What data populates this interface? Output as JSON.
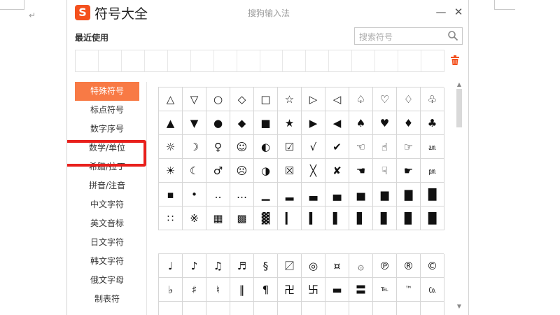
{
  "app": {
    "title": "符号大全",
    "logo_text": "S",
    "ime_name": "搜狗输入法",
    "minimize_glyph": "—",
    "close_glyph": "✕"
  },
  "recent": {
    "label": "最近使用",
    "cell_count": 16
  },
  "search": {
    "placeholder": "搜索符号"
  },
  "sidebar": {
    "items": [
      {
        "label": "特殊符号",
        "active": true
      },
      {
        "label": "标点符号"
      },
      {
        "label": "数字序号"
      },
      {
        "label": "数学/单位",
        "highlighted": true
      },
      {
        "label": "希腊/拉丁"
      },
      {
        "label": "拼音/注音"
      },
      {
        "label": "中文字符"
      },
      {
        "label": "英文音标"
      },
      {
        "label": "日文字符"
      },
      {
        "label": "韩文字符"
      },
      {
        "label": "俄文字母"
      },
      {
        "label": "制表符"
      }
    ]
  },
  "symbols_block1": [
    "△",
    "▽",
    "○",
    "◇",
    "□",
    "☆",
    "▷",
    "◁",
    "♤",
    "♡",
    "♢",
    "♧",
    "▲",
    "▼",
    "●",
    "◆",
    "■",
    "★",
    "▶",
    "◀",
    "♠",
    "♥",
    "♦",
    "♣",
    "☼",
    "☽",
    "♀",
    "☺",
    "◐",
    "☑",
    "√",
    "✔",
    "☜",
    "☝",
    "☞",
    "㏂",
    "☀",
    "☾",
    "♂",
    "☹",
    "◑",
    "☒",
    "╳",
    "✘",
    "☚",
    "☟",
    "☛",
    "㏘",
    "▪",
    "•",
    "‥",
    "…",
    "▁",
    "▂",
    "▃",
    "▄",
    "▅",
    "▆",
    "▇",
    "█",
    "∷",
    "※",
    "▦",
    "▩",
    "▓",
    "▎",
    "▍",
    "▌",
    "▋",
    "▊",
    "▉",
    "█"
  ],
  "symbols_block2": [
    "♩",
    "♪",
    "♫",
    "♬",
    "§",
    "〼",
    "◎",
    "¤",
    "۞",
    "℗",
    "®",
    "©",
    "♭",
    "♯",
    "♮",
    "‖",
    "¶",
    "卍",
    "卐",
    "▬",
    "〓",
    "℡",
    "™",
    "㏇",
    "",
    "",
    "",
    "",
    "",
    "",
    "",
    "",
    "",
    "",
    "",
    ""
  ],
  "colors": {
    "accent": "#f87a45",
    "logo": "#f4511e",
    "highlight_box": "#e8201c"
  }
}
